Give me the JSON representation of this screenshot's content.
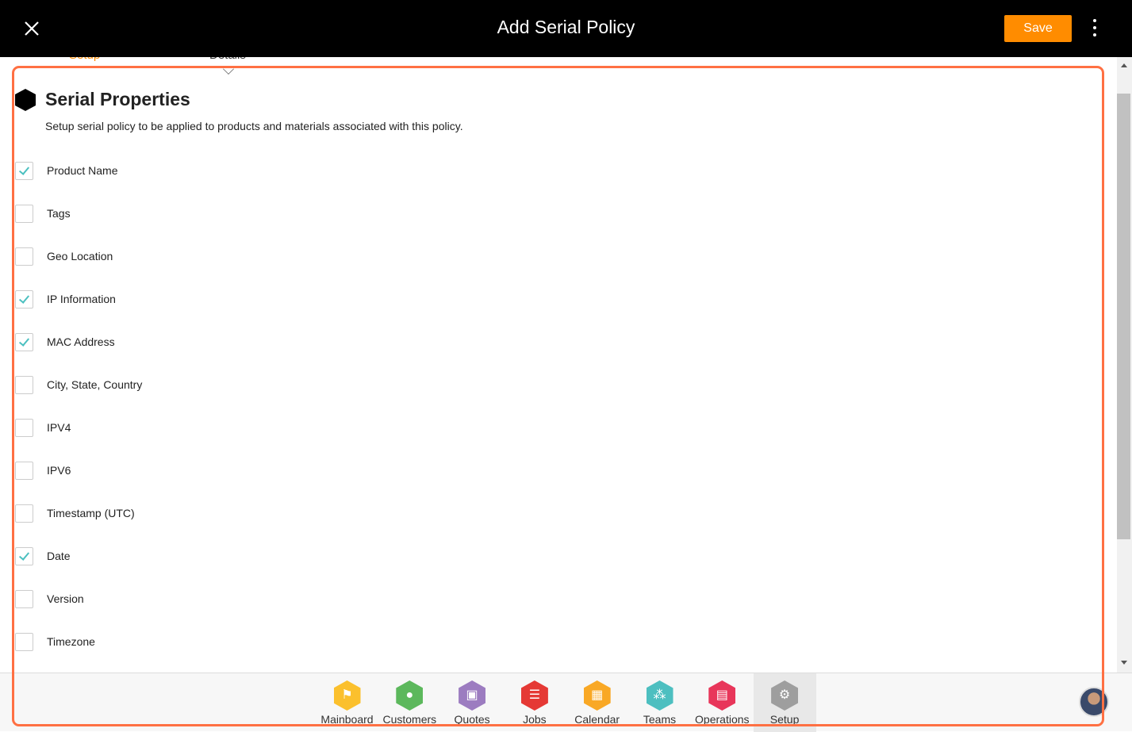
{
  "header": {
    "title": "Add Serial Policy",
    "save_label": "Save"
  },
  "tabs": [
    "Setup",
    "Details"
  ],
  "section": {
    "title": "Serial Properties",
    "description": "Setup serial policy to be applied to products and materials associated with this policy."
  },
  "properties": [
    {
      "label": "Product Name",
      "checked": true
    },
    {
      "label": "Tags",
      "checked": false
    },
    {
      "label": "Geo Location",
      "checked": false
    },
    {
      "label": "IP Information",
      "checked": true
    },
    {
      "label": "MAC Address",
      "checked": true
    },
    {
      "label": "City, State, Country",
      "checked": false
    },
    {
      "label": "IPV4",
      "checked": false
    },
    {
      "label": "IPV6",
      "checked": false
    },
    {
      "label": "Timestamp (UTC)",
      "checked": false
    },
    {
      "label": "Date",
      "checked": true
    },
    {
      "label": "Version",
      "checked": false
    },
    {
      "label": "Timezone",
      "checked": false
    }
  ],
  "nav": [
    {
      "label": "Mainboard",
      "color": "#fbc02d",
      "icon": "mainboard-icon",
      "glyph": "⚑"
    },
    {
      "label": "Customers",
      "color": "#5cb85c",
      "icon": "user-icon",
      "glyph": "●"
    },
    {
      "label": "Quotes",
      "color": "#9c7cc0",
      "icon": "quotes-icon",
      "glyph": "▣"
    },
    {
      "label": "Jobs",
      "color": "#e53935",
      "icon": "list-icon",
      "glyph": "☰"
    },
    {
      "label": "Calendar",
      "color": "#f9a825",
      "icon": "calendar-icon",
      "glyph": "▦"
    },
    {
      "label": "Teams",
      "color": "#4dbfc0",
      "icon": "teams-icon",
      "glyph": "⁂"
    },
    {
      "label": "Operations",
      "color": "#e8365a",
      "icon": "briefcase-icon",
      "glyph": "▤"
    },
    {
      "label": "Setup",
      "color": "#9e9e9e",
      "icon": "gear-icon",
      "glyph": "⚙",
      "active": true
    }
  ]
}
